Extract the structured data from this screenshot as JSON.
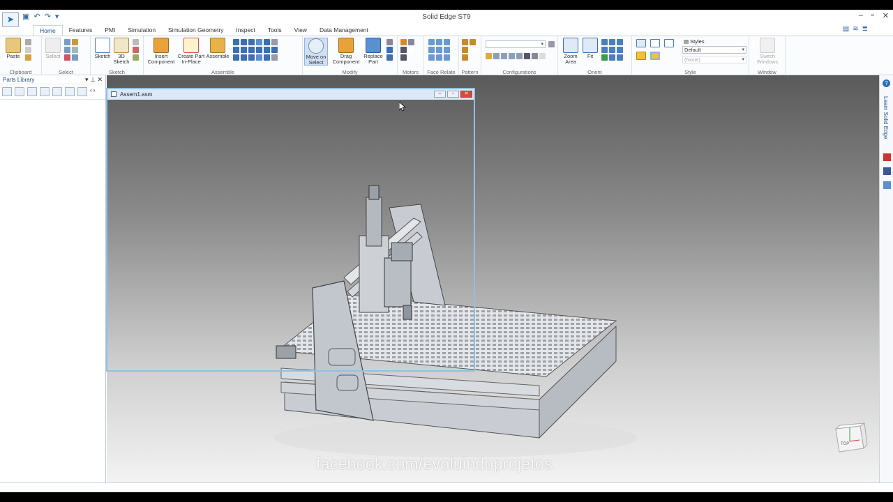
{
  "window": {
    "title": "Solid Edge ST9",
    "controls": [
      "–",
      "▫",
      "✕"
    ]
  },
  "tabs": [
    "Home",
    "Features",
    "PMI",
    "Simulation",
    "Simulation Geometry",
    "Inspect",
    "Tools",
    "View",
    "Data Management"
  ],
  "ribbon": {
    "clipboard": {
      "label": "Clipboard",
      "paste": "Paste"
    },
    "select": {
      "label": "Select",
      "select": "Select"
    },
    "sketch": {
      "label": "Sketch",
      "sketch": "Sketch",
      "sketch3d_line1": "3D",
      "sketch3d_line2": "Sketch"
    },
    "assemble": {
      "label": "Assemble",
      "insert_line1": "Insert",
      "insert_line2": "Component",
      "create_line1": "Create Part",
      "create_line2": "In-Place",
      "assemble": "Assemble"
    },
    "modify": {
      "label": "Modify",
      "move_line1": "Move on",
      "move_line2": "Select",
      "drag_line1": "Drag",
      "drag_line2": "Component",
      "replace_line1": "Replace",
      "replace_line2": "Part"
    },
    "motors": {
      "label": "Motors"
    },
    "face_relate": {
      "label": "Face Relate"
    },
    "pattern": {
      "label": "Pattern"
    },
    "configurations": {
      "label": "Configurations",
      "combo_value": ""
    },
    "orient": {
      "label": "Orient",
      "zoom_line1": "Zoom",
      "zoom_line2": "Area",
      "fit": "Fit"
    },
    "style": {
      "label": "Style",
      "styles": "Styles",
      "default": "Default",
      "none": "(None)"
    },
    "window": {
      "label": "Window",
      "switch_line1": "Switch",
      "switch_line2": "Windows"
    }
  },
  "parts_library": {
    "title": "Parts Library"
  },
  "subwindow": {
    "title": "Assem1.asm"
  },
  "right_strip": {
    "learn": "Learn Solid Edge"
  },
  "view_cube": {
    "label": "TOP"
  },
  "watermark": "facebook.com/evoluindoprojetos",
  "colors": {
    "accent": "#1a4f8a",
    "status_bar": "#274e86",
    "subwindow_border": "#8fc1e3"
  }
}
